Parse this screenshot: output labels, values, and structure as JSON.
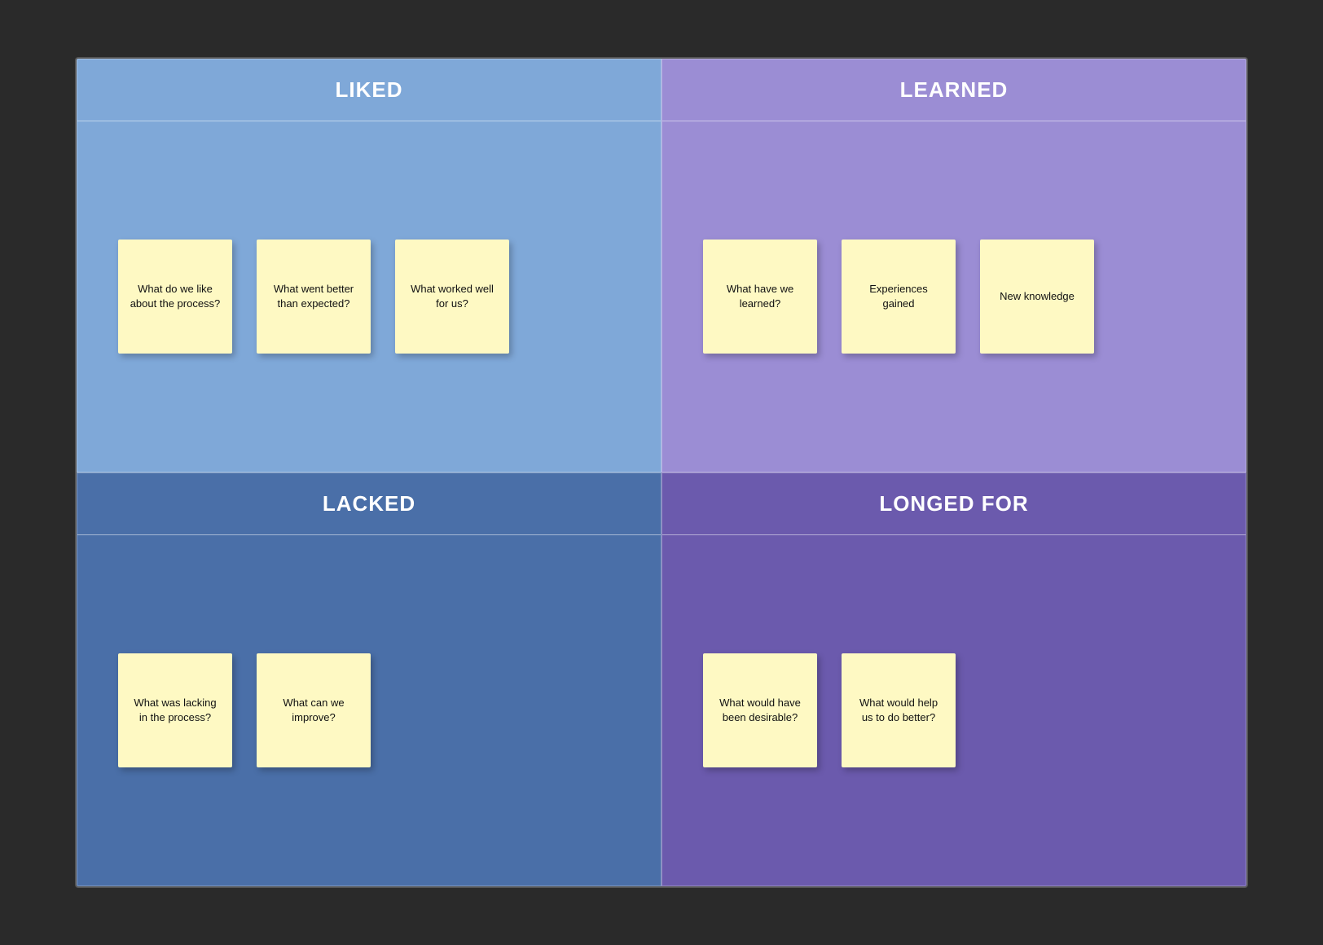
{
  "quadrants": [
    {
      "id": "liked",
      "label": "LIKED",
      "colorClass": "quadrant-liked",
      "notes": [
        {
          "text": "What do we like about the process?"
        },
        {
          "text": "What went better than expected?"
        },
        {
          "text": "What worked well for us?"
        }
      ]
    },
    {
      "id": "learned",
      "label": "LEARNED",
      "colorClass": "quadrant-learned",
      "notes": [
        {
          "text": "What have we learned?"
        },
        {
          "text": "Experiences gained"
        },
        {
          "text": "New knowledge"
        }
      ]
    },
    {
      "id": "lacked",
      "label": "LACKED",
      "colorClass": "quadrant-lacked",
      "notes": [
        {
          "text": "What was lacking in the process?"
        },
        {
          "text": "What can we improve?"
        }
      ]
    },
    {
      "id": "longed",
      "label": "LONGED FOR",
      "colorClass": "quadrant-longed",
      "notes": [
        {
          "text": "What would have been desirable?"
        },
        {
          "text": "What would help us to do better?"
        }
      ]
    }
  ]
}
